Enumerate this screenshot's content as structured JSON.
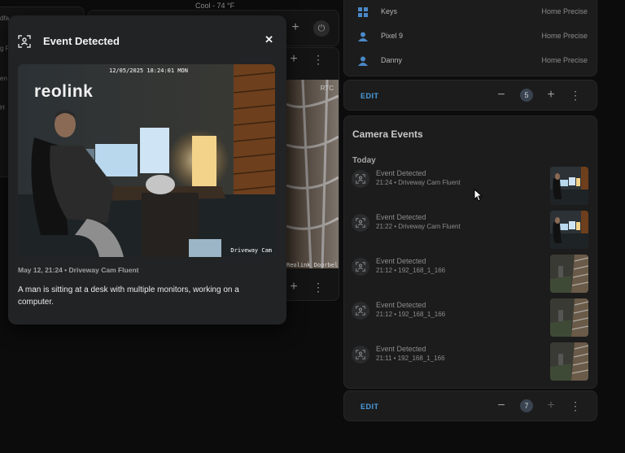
{
  "header": {
    "thermostat": "Cool - 74 °F"
  },
  "left_fragments": [
    "dfa",
    "g R",
    "en",
    "H"
  ],
  "camera_label": "RTC",
  "doorbell_label": "Reolink Doorbell",
  "people_card": {
    "rows": [
      {
        "name": "Keys",
        "status": "Home Precise",
        "icon": "grid-icon"
      },
      {
        "name": "Pixel 9",
        "status": "Home Precise",
        "icon": "person-icon"
      },
      {
        "name": "Danny",
        "status": "Home Precise",
        "icon": "person-icon"
      }
    ],
    "edit_label": "EDIT",
    "count": "5"
  },
  "camera_events": {
    "title": "Camera Events",
    "section": "Today",
    "events": [
      {
        "title": "Event Detected",
        "sub": "21:24 • Driveway Cam Fluent",
        "thumb": "office"
      },
      {
        "title": "Event Detected",
        "sub": "21:22 • Driveway Cam Fluent",
        "thumb": "office"
      },
      {
        "title": "Event Detected",
        "sub": "21:12 • 192_168_1_166",
        "thumb": "yard"
      },
      {
        "title": "Event Detected",
        "sub": "21:12 • 192_168_1_166",
        "thumb": "yard"
      },
      {
        "title": "Event Detected",
        "sub": "21:11 • 192_168_1_166",
        "thumb": "yard"
      }
    ],
    "edit_label": "EDIT",
    "count": "7"
  },
  "modal": {
    "title": "Event Detected",
    "close": "✕",
    "brand": "reolink",
    "timestamp": "12/05/2025 18:24:01 MON",
    "cam_overlay": "Driveway Cam",
    "caption": "May 12, 21:24 • Driveway Cam Fluent",
    "description": "A man is sitting at a desk with multiple monitors, working on a computer."
  },
  "colors": {
    "accent": "#4a9de0",
    "card": "#1c1c1c",
    "modal": "#222324"
  }
}
